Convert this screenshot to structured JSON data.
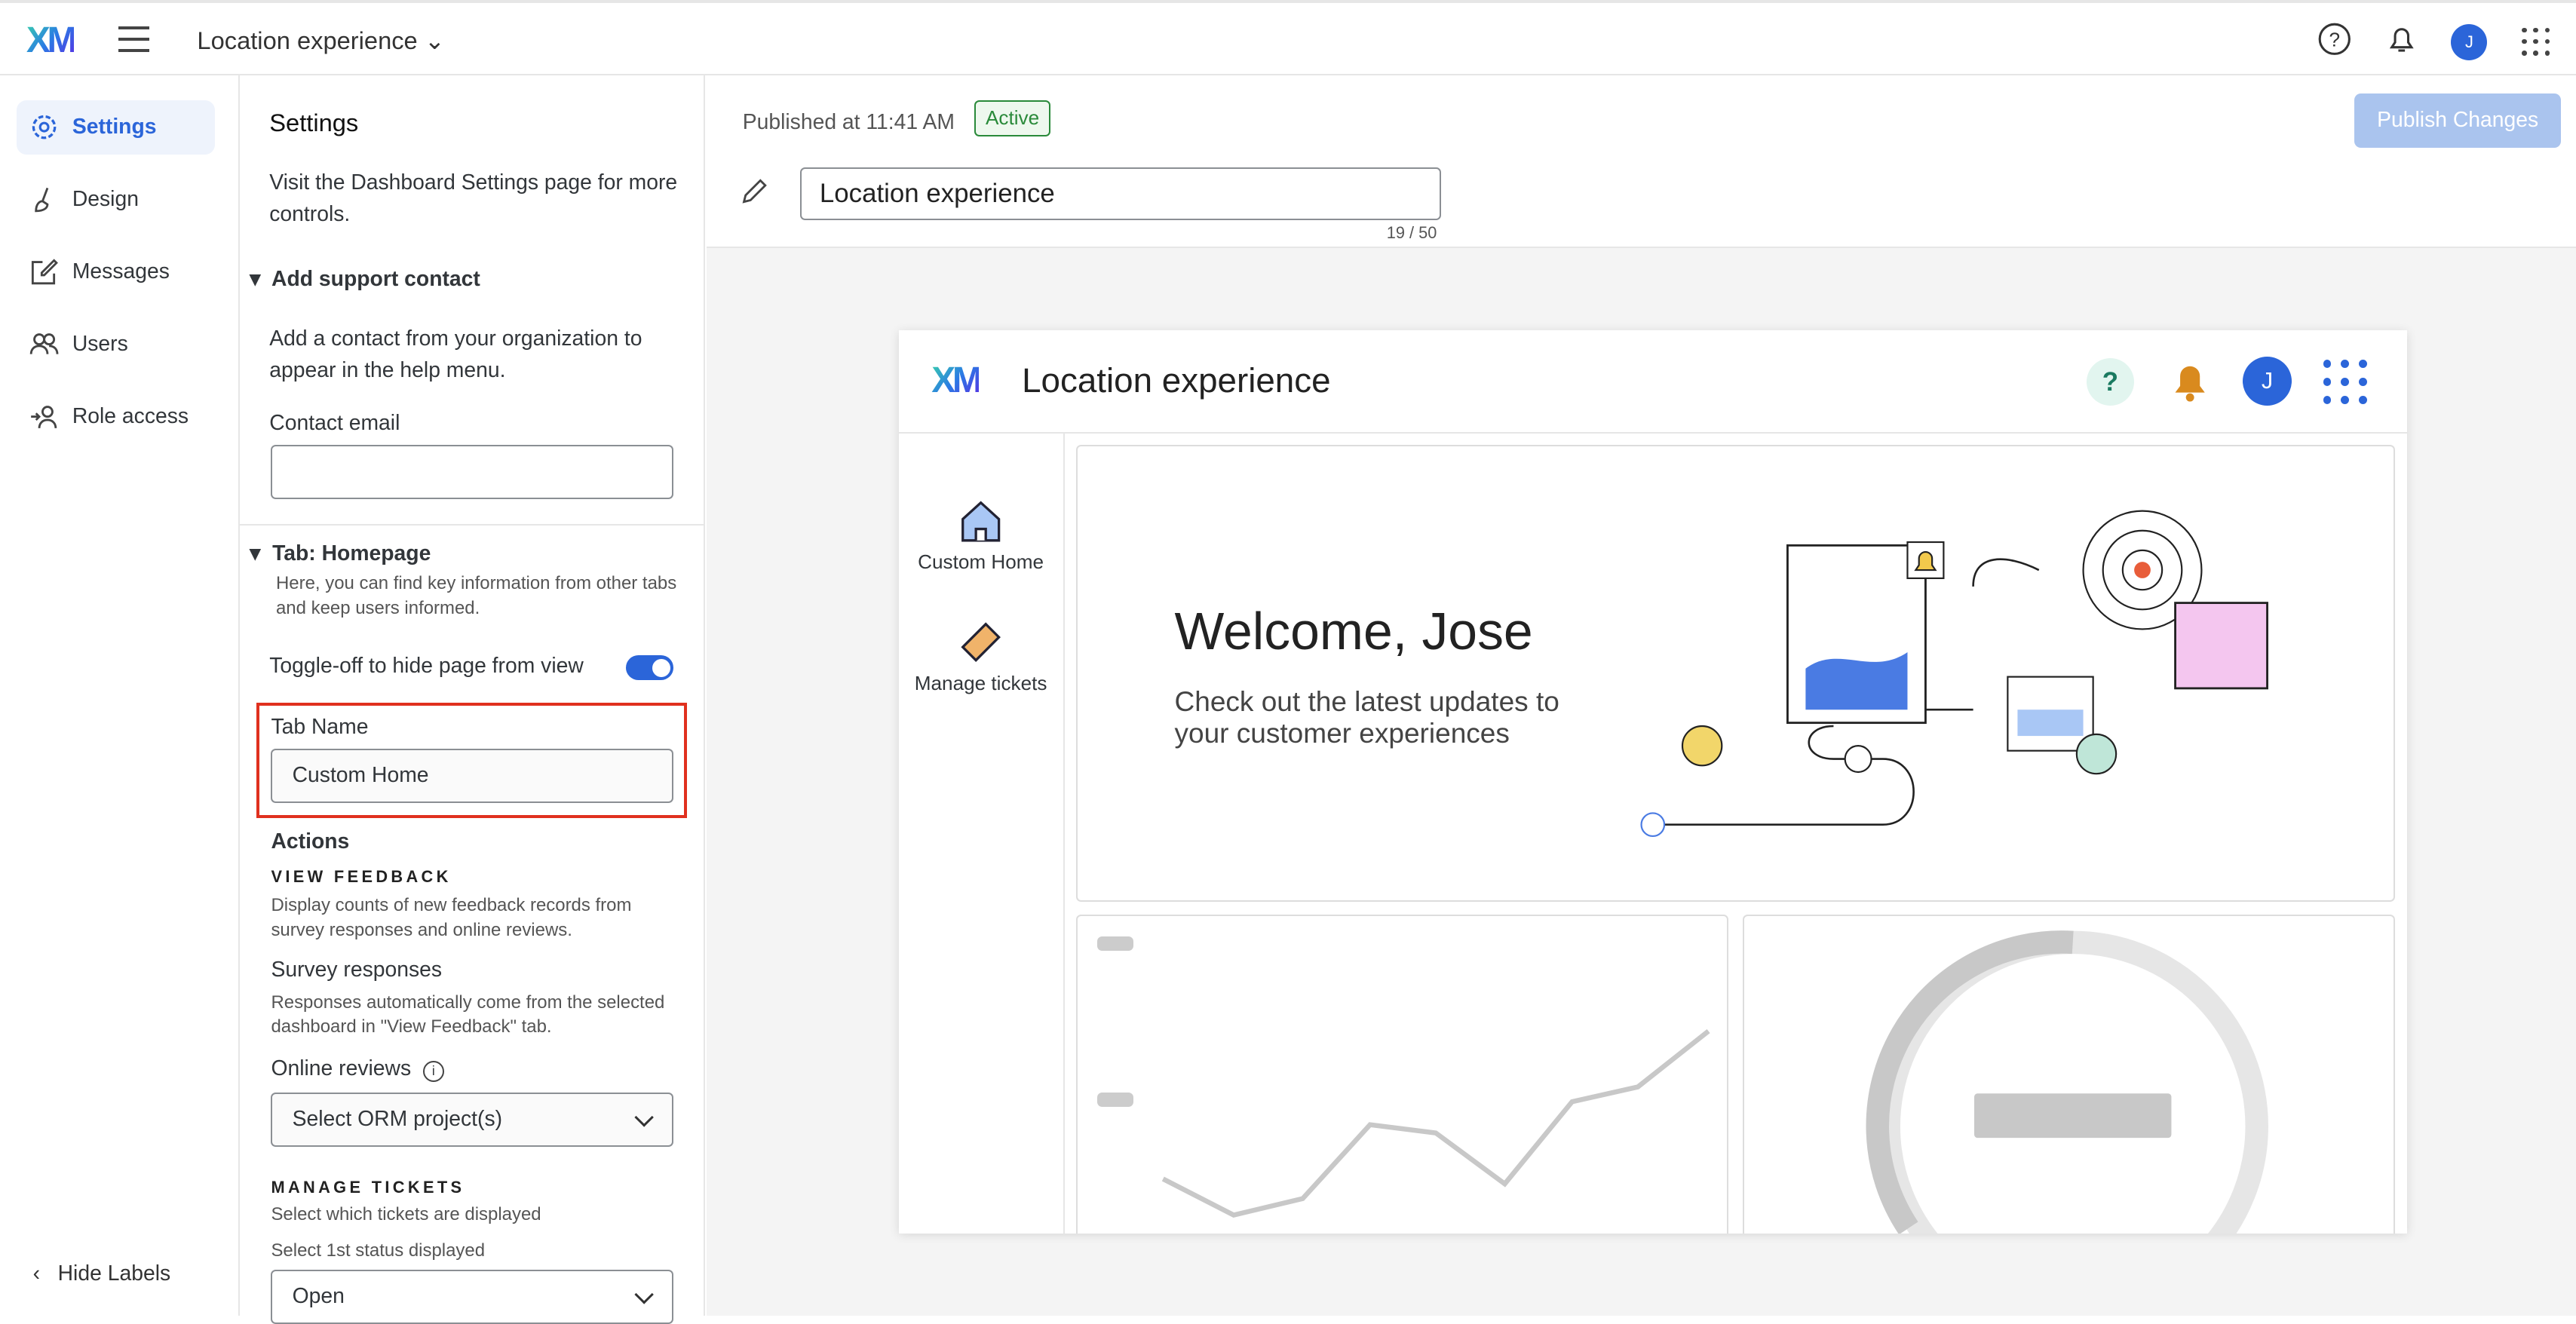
{
  "topbar": {
    "logo": "XM",
    "project": "Location experience",
    "avatar": "J"
  },
  "nav": {
    "items": [
      {
        "label": "Settings"
      },
      {
        "label": "Design"
      },
      {
        "label": "Messages"
      },
      {
        "label": "Users"
      },
      {
        "label": "Role access"
      }
    ],
    "hide_labels": "Hide Labels"
  },
  "panel": {
    "title": "Settings",
    "intro": "Visit the Dashboard Settings page for more controls.",
    "support": {
      "heading": "Add support contact",
      "desc": "Add a contact from your organization to appear in the help menu.",
      "email_label": "Contact email",
      "email_value": ""
    },
    "tab": {
      "heading": "Tab: Homepage",
      "desc": "Here, you can find key information from other tabs and keep users informed.",
      "toggle_label": "Toggle-off to hide page from view",
      "toggle_on": true,
      "name_label": "Tab Name",
      "name_value": "Custom Home"
    },
    "actions": {
      "heading": "Actions",
      "view_feedback": "VIEW FEEDBACK",
      "vf_desc": "Display counts of new feedback records from survey responses and online reviews.",
      "survey_label": "Survey responses",
      "survey_desc": "Responses automatically come from the selected dashboard in \"View Feedback\" tab.",
      "reviews_label": "Online reviews",
      "reviews_select": "Select ORM project(s)",
      "manage_tickets": "MANAGE TICKETS",
      "mt_desc": "Select which tickets are displayed",
      "status_label": "Select 1st status displayed",
      "status_select": "Open"
    }
  },
  "main": {
    "published": "Published at 11:41 AM",
    "status": "Active",
    "publish_button": "Publish Changes",
    "title_value": "Location experience",
    "char_count": "19 / 50"
  },
  "preview": {
    "logo": "XM",
    "title": "Location experience",
    "avatar": "J",
    "tabs": [
      {
        "label": "Custom Home"
      },
      {
        "label": "Manage tickets"
      }
    ],
    "welcome": "Welcome, Jose",
    "subtitle": "Check out the latest updates to your customer experiences"
  }
}
